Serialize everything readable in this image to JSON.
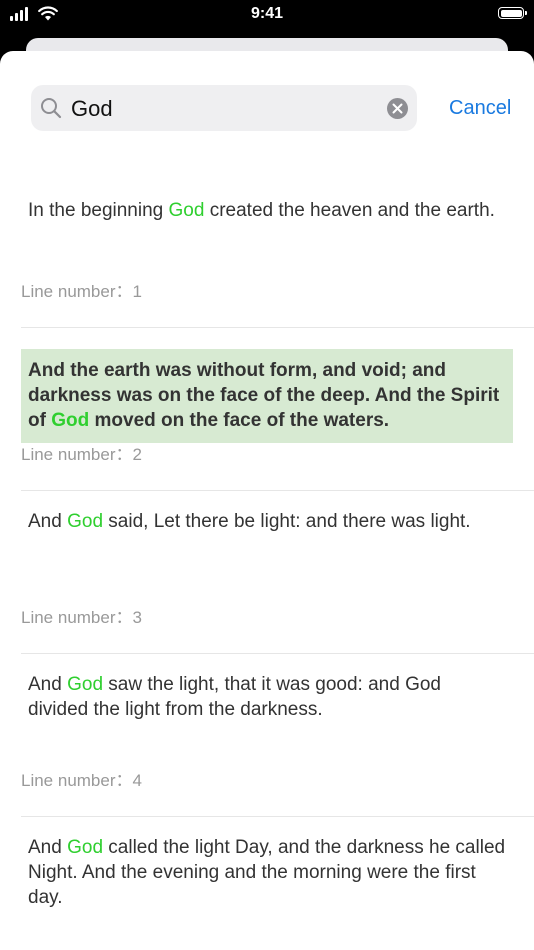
{
  "status": {
    "time": "9:41"
  },
  "search": {
    "query": "God",
    "cancel_label": "Cancel"
  },
  "results": [
    {
      "before": "In the beginning ",
      "match": "God",
      "after": " created the heaven and the earth.",
      "line_label": "Line number：1",
      "selected": false
    },
    {
      "before": "And the earth was without form, and void; and darkness was on the face of the deep. And the Spirit of ",
      "match": "God",
      "after": " moved on the face of the waters.",
      "line_label": "Line number：2",
      "selected": true
    },
    {
      "before": "And ",
      "match": "God",
      "after": " said, Let there be light: and there was light.",
      "line_label": "Line number：3",
      "selected": false
    },
    {
      "before": "And ",
      "match": "God",
      "after": " saw the light, that it was good: and God divided the light from the darkness.",
      "line_label": "Line number：4",
      "selected": false
    },
    {
      "before": "And ",
      "match": "God",
      "after": " called the light Day, and the darkness he called Night. And the evening and the morning were the first day.",
      "line_label": "",
      "selected": false
    }
  ],
  "colors": {
    "highlight": "#2fcf2f",
    "selected_bg": "#d7ead2",
    "accent": "#1a7ae0"
  }
}
